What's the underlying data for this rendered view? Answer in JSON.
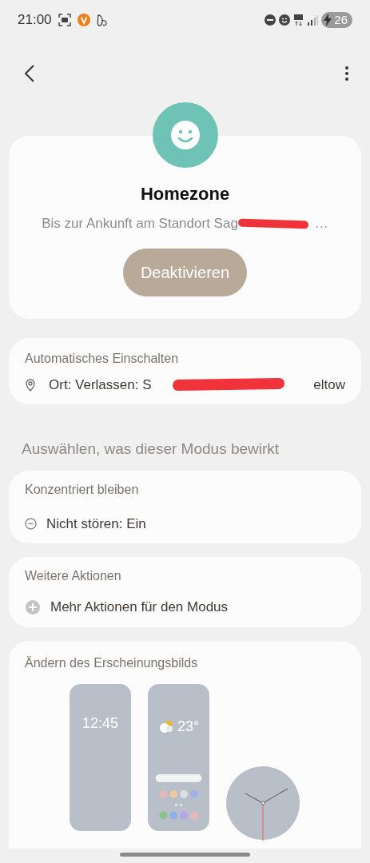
{
  "status_bar": {
    "time": "21:00",
    "battery": "26"
  },
  "header": {
    "title": "Homezone",
    "subtitle": "Bis zur Ankunft am Standort Sag",
    "subtitle_end": "…",
    "button": "Deaktivieren"
  },
  "auto_on": {
    "heading": "Automatisches Einschalten",
    "location_start": "Ort: Verlassen: S",
    "location_end": "eltow"
  },
  "section_title": "Auswählen, was dieser Modus bewirkt",
  "cards": [
    {
      "heading": "Konzentriert bleiben",
      "item": "Nicht stören: Ein",
      "kind": "minus"
    },
    {
      "heading": "Weitere Aktionen",
      "item": "Mehr Aktionen für den Modus",
      "kind": "plus"
    }
  ],
  "appearance": {
    "heading": "Ändern des Erscheinungsbilds",
    "lock_time": "12:45",
    "temperature": "23°"
  }
}
